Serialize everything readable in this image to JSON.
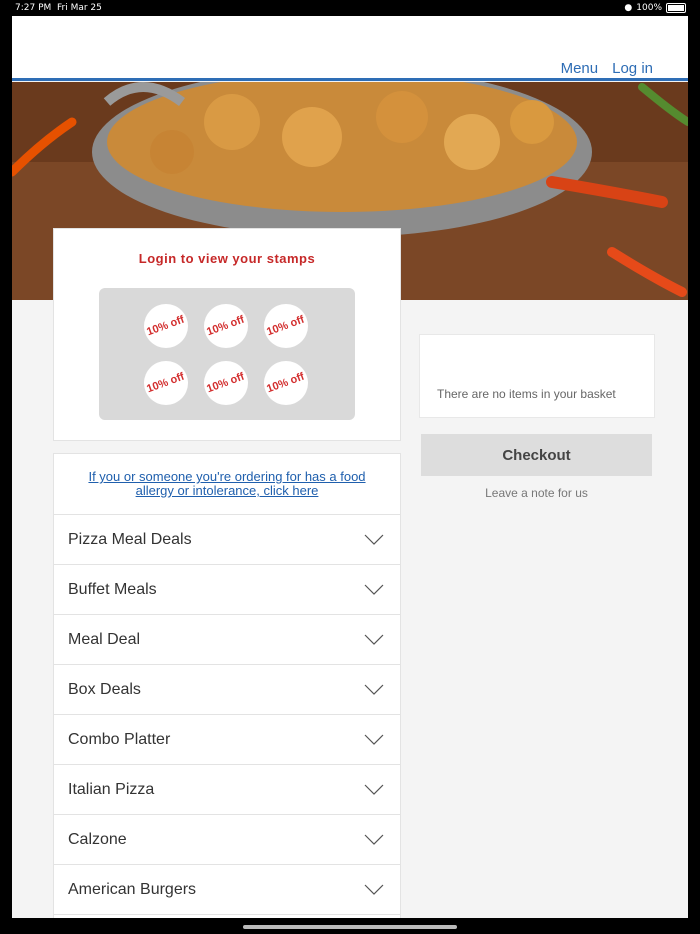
{
  "status": {
    "time": "7:27 PM",
    "date": "Fri Mar 25",
    "battery": "100%"
  },
  "nav": {
    "menu": "Menu",
    "login": "Log in"
  },
  "stamps": {
    "title": "Login to view your stamps",
    "items": [
      "10% off",
      "10% off",
      "10% off",
      "10% off",
      "10% off",
      "10% off"
    ]
  },
  "allergy_link": "If you or someone you're ordering for has a food allergy or intolerance, click here",
  "categories": [
    "Pizza Meal Deals",
    "Buffet Meals",
    "Meal Deal",
    "Box Deals",
    "Combo Platter",
    "Italian Pizza",
    "Calzone",
    "American Burgers"
  ],
  "basket": {
    "empty_text": "There are no items in your basket",
    "checkout_label": "Checkout",
    "note_label": "Leave a note for us"
  },
  "colors": {
    "accent": "#2e6db5",
    "stamp_red": "#d32f2f"
  }
}
